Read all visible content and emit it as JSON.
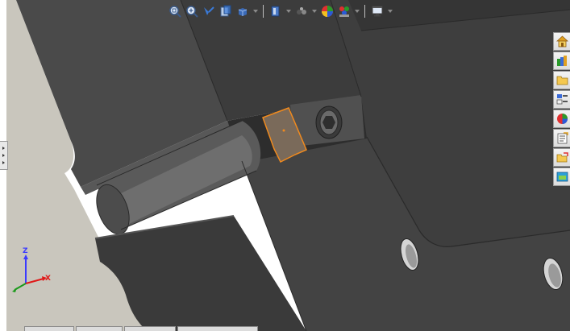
{
  "hud_toolbar": {
    "tools": [
      {
        "name": "zoom-to-fit-icon"
      },
      {
        "name": "zoom-to-area-icon"
      },
      {
        "name": "previous-view-icon"
      },
      {
        "name": "section-view-icon"
      },
      {
        "name": "view-orientation-icon",
        "dropdown": true
      },
      {
        "name": "display-style-icon",
        "dropdown": true
      },
      {
        "name": "hide-show-items-icon",
        "dropdown": true
      },
      {
        "name": "edit-appearance-icon"
      },
      {
        "name": "apply-scene-icon",
        "dropdown": true
      },
      {
        "name": "view-settings-icon",
        "dropdown": true
      }
    ]
  },
  "task_pane": {
    "tabs": [
      {
        "name": "resources-home-icon"
      },
      {
        "name": "design-library-icon"
      },
      {
        "name": "file-explorer-icon"
      },
      {
        "name": "view-palette-icon"
      },
      {
        "name": "appearances-scenes-icon"
      },
      {
        "name": "custom-properties-icon"
      },
      {
        "name": "open-folder-icon"
      },
      {
        "name": "display-manager-icon"
      }
    ]
  },
  "triad": {
    "z_label": "Z",
    "x_label": "X",
    "colors": {
      "z": "#3a3aff",
      "x": "#e01818",
      "y": "#1a9a1a"
    }
  },
  "colors": {
    "part_dark": "#3f3f3f",
    "part_mid": "#565656",
    "part_light": "#6a6a6a",
    "background_part": "#c9c6bd",
    "selection": "#f08a1e"
  }
}
